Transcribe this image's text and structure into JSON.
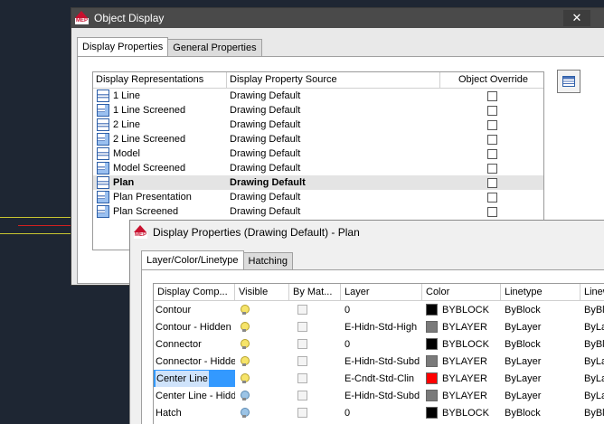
{
  "object_display": {
    "title": "Object Display",
    "close": "✕",
    "tabs": [
      "Display Properties",
      "General Properties"
    ],
    "headers": {
      "rep": "Display Representations",
      "src": "Display Property Source",
      "ovr": "Object Override"
    },
    "rows": [
      {
        "name": "1 Line",
        "source": "Drawing Default"
      },
      {
        "name": "1 Line Screened",
        "source": "Drawing Default"
      },
      {
        "name": "2 Line",
        "source": "Drawing Default"
      },
      {
        "name": "2 Line Screened",
        "source": "Drawing Default"
      },
      {
        "name": "Model",
        "source": "Drawing Default"
      },
      {
        "name": "Model Screened",
        "source": "Drawing Default"
      },
      {
        "name": "Plan",
        "source": "Drawing Default"
      },
      {
        "name": "Plan Presentation",
        "source": "Drawing Default"
      },
      {
        "name": "Plan Screened",
        "source": "Drawing Default"
      }
    ],
    "selected_row": "Plan"
  },
  "display_properties": {
    "title": "Display Properties (Drawing Default) - Plan",
    "tabs": [
      "Layer/Color/Linetype",
      "Hatching"
    ],
    "headers": {
      "comp": "Display Comp...",
      "vis": "Visible",
      "bym": "By Mat...",
      "layer": "Layer",
      "color": "Color",
      "linetype": "Linetype",
      "lineweight": "Linew"
    },
    "rows": [
      {
        "comp": "Contour",
        "visible": "on",
        "layer": "0",
        "color": "BYBLOCK",
        "swatch": "#000000",
        "linetype": "ByBlock",
        "lineweight": "ByBlo"
      },
      {
        "comp": "Contour - Hidden",
        "visible": "on",
        "layer": "E-Hidn-Std-High",
        "color": "BYLAYER",
        "swatch": "#7a7a7a",
        "linetype": "ByLayer",
        "lineweight": "ByLay"
      },
      {
        "comp": "Connector",
        "visible": "on",
        "layer": "0",
        "color": "BYBLOCK",
        "swatch": "#000000",
        "linetype": "ByBlock",
        "lineweight": "ByBlo"
      },
      {
        "comp": "Connector - Hidde",
        "visible": "on",
        "layer": "E-Hidn-Std-Subd",
        "color": "BYLAYER",
        "swatch": "#7a7a7a",
        "linetype": "ByLayer",
        "lineweight": "ByLay"
      },
      {
        "comp": "Center Line",
        "visible": "on",
        "layer": "E-Cndt-Std-Clin",
        "color": "BYLAYER",
        "swatch": "#ff0000",
        "linetype": "ByLayer",
        "lineweight": "ByLay"
      },
      {
        "comp": "Center Line - Hidd",
        "visible": "off",
        "layer": "E-Hidn-Std-Subd",
        "color": "BYLAYER",
        "swatch": "#7a7a7a",
        "linetype": "ByLayer",
        "lineweight": "ByLay"
      },
      {
        "comp": "Hatch",
        "visible": "off",
        "layer": "0",
        "color": "BYBLOCK",
        "swatch": "#000000",
        "linetype": "ByBlock",
        "lineweight": "ByBlo"
      }
    ],
    "selected_row": "Center Line"
  }
}
